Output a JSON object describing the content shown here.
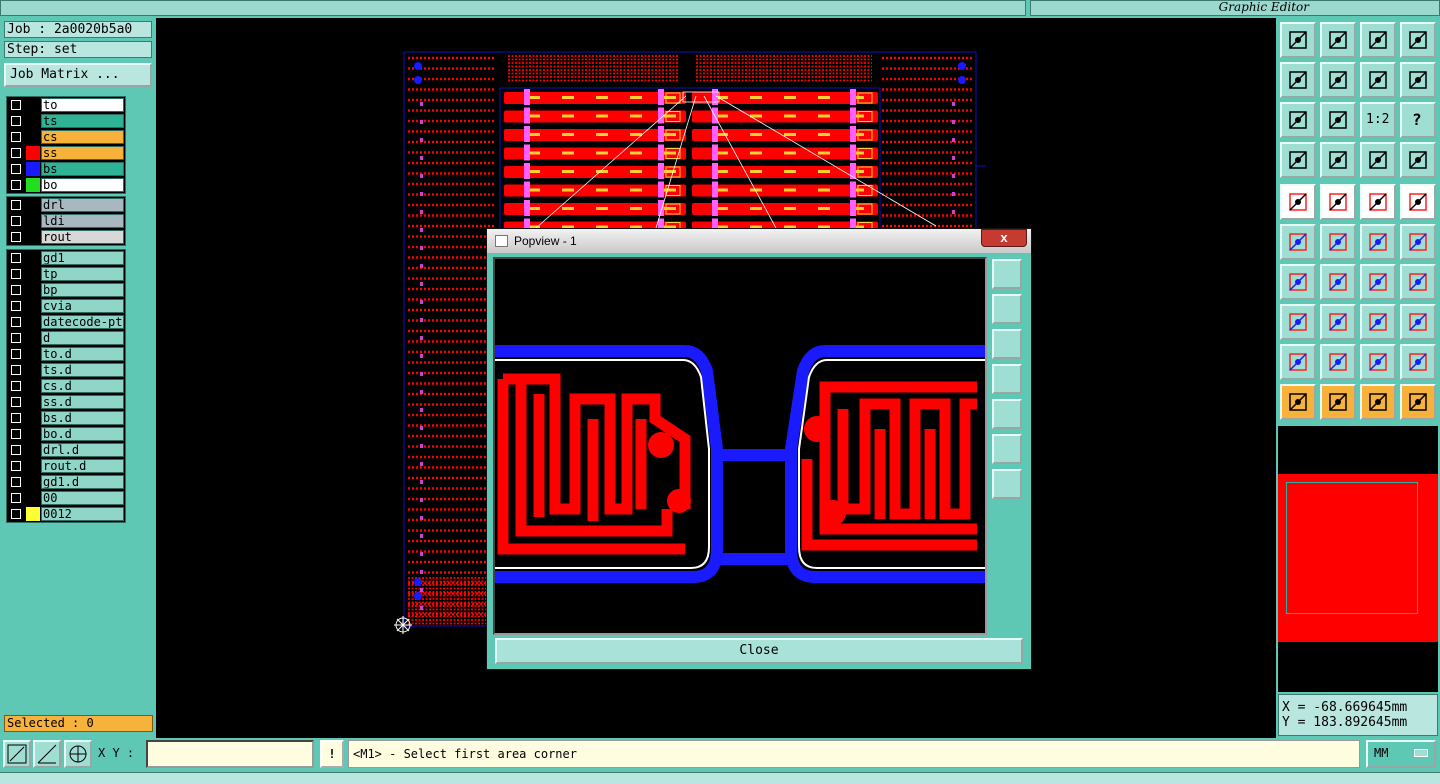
{
  "header": {
    "logo": "",
    "subtitle": "Graphic Editor"
  },
  "job": {
    "job_label": "Job : 2a0020b5a0",
    "step_label": "Step: set",
    "matrix_button": "Job Matrix ..."
  },
  "layers": {
    "group1": [
      {
        "name": "to",
        "bg": "#ffffff",
        "swatch": null
      },
      {
        "name": "ts",
        "bg": "#2fb394",
        "swatch": null
      },
      {
        "name": "cs",
        "bg": "#f6b23a",
        "swatch": null
      },
      {
        "name": "ss",
        "bg": "#f6b23a",
        "swatch": "#ff0000"
      },
      {
        "name": "bs",
        "bg": "#2fb394",
        "swatch": "#1a1aff"
      },
      {
        "name": "bo",
        "bg": "#ffffff",
        "swatch": "#22dd22"
      }
    ],
    "group2": [
      {
        "name": "drl",
        "bg": "#a8b8c0",
        "swatch": null
      },
      {
        "name": "ldi",
        "bg": "#a8b8c0",
        "swatch": null
      },
      {
        "name": "rout",
        "bg": "#d8d8d8",
        "swatch": null
      }
    ],
    "group3": [
      {
        "name": "gd1",
        "bg": "#8fd6c9",
        "swatch": null
      },
      {
        "name": "tp",
        "bg": "#8fd6c9",
        "swatch": null
      },
      {
        "name": "bp",
        "bg": "#8fd6c9",
        "swatch": null
      },
      {
        "name": "cvia",
        "bg": "#8fd6c9",
        "swatch": null
      },
      {
        "name": "datecode-ptc",
        "bg": "#8fd6c9",
        "swatch": null
      },
      {
        "name": "d",
        "bg": "#8fd6c9",
        "swatch": null
      },
      {
        "name": "to.d",
        "bg": "#8fd6c9",
        "swatch": null
      },
      {
        "name": "ts.d",
        "bg": "#8fd6c9",
        "swatch": null
      },
      {
        "name": "cs.d",
        "bg": "#8fd6c9",
        "swatch": null
      },
      {
        "name": "ss.d",
        "bg": "#8fd6c9",
        "swatch": null
      },
      {
        "name": "bs.d",
        "bg": "#8fd6c9",
        "swatch": null
      },
      {
        "name": "bo.d",
        "bg": "#8fd6c9",
        "swatch": null
      },
      {
        "name": "drl.d",
        "bg": "#8fd6c9",
        "swatch": null
      },
      {
        "name": "rout.d",
        "bg": "#8fd6c9",
        "swatch": null
      },
      {
        "name": "gd1.d",
        "bg": "#8fd6c9",
        "swatch": null
      },
      {
        "name": "00",
        "bg": "#8fd6c9",
        "swatch": null
      },
      {
        "name": "0012",
        "bg": "#8fd6c9",
        "swatch": "#ffff33"
      }
    ]
  },
  "selected_label": "Selected : 0",
  "popview": {
    "title": "Popview - 1",
    "close_x": "x",
    "close_button": "Close"
  },
  "coords": {
    "x_readout": "X = -68.669645mm",
    "y_readout": "Y = 183.892645mm"
  },
  "bottombar": {
    "xy_label": "X Y :",
    "xy_value": "",
    "info_icon": "!",
    "prompt": "<M1> - Select first area corner",
    "units": "MM"
  },
  "right_tools": {
    "ratio_label": "1:2",
    "help_label": "?"
  },
  "colors": {
    "panel": "#5fc8b4",
    "copper_red": "#ff0000",
    "trace_blue": "#1a1aff",
    "outline_blue": "#1010c0",
    "highlight_orange": "#f6b23a"
  }
}
